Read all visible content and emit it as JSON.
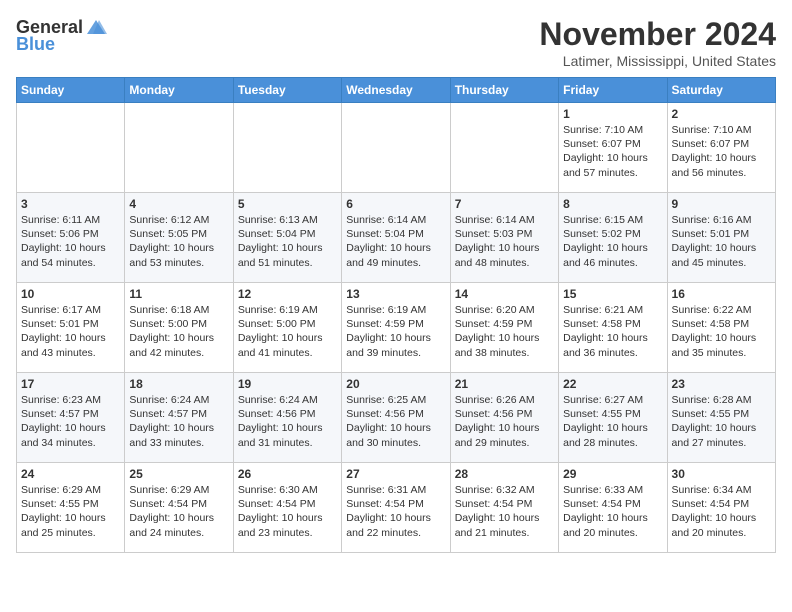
{
  "header": {
    "logo_general": "General",
    "logo_blue": "Blue",
    "month_title": "November 2024",
    "location": "Latimer, Mississippi, United States"
  },
  "weekdays": [
    "Sunday",
    "Monday",
    "Tuesday",
    "Wednesday",
    "Thursday",
    "Friday",
    "Saturday"
  ],
  "weeks": [
    [
      {
        "day": "",
        "info": ""
      },
      {
        "day": "",
        "info": ""
      },
      {
        "day": "",
        "info": ""
      },
      {
        "day": "",
        "info": ""
      },
      {
        "day": "",
        "info": ""
      },
      {
        "day": "1",
        "info": "Sunrise: 7:10 AM\nSunset: 6:07 PM\nDaylight: 10 hours\nand 57 minutes."
      },
      {
        "day": "2",
        "info": "Sunrise: 7:10 AM\nSunset: 6:07 PM\nDaylight: 10 hours\nand 56 minutes."
      }
    ],
    [
      {
        "day": "3",
        "info": "Sunrise: 6:11 AM\nSunset: 5:06 PM\nDaylight: 10 hours\nand 54 minutes."
      },
      {
        "day": "4",
        "info": "Sunrise: 6:12 AM\nSunset: 5:05 PM\nDaylight: 10 hours\nand 53 minutes."
      },
      {
        "day": "5",
        "info": "Sunrise: 6:13 AM\nSunset: 5:04 PM\nDaylight: 10 hours\nand 51 minutes."
      },
      {
        "day": "6",
        "info": "Sunrise: 6:14 AM\nSunset: 5:04 PM\nDaylight: 10 hours\nand 49 minutes."
      },
      {
        "day": "7",
        "info": "Sunrise: 6:14 AM\nSunset: 5:03 PM\nDaylight: 10 hours\nand 48 minutes."
      },
      {
        "day": "8",
        "info": "Sunrise: 6:15 AM\nSunset: 5:02 PM\nDaylight: 10 hours\nand 46 minutes."
      },
      {
        "day": "9",
        "info": "Sunrise: 6:16 AM\nSunset: 5:01 PM\nDaylight: 10 hours\nand 45 minutes."
      }
    ],
    [
      {
        "day": "10",
        "info": "Sunrise: 6:17 AM\nSunset: 5:01 PM\nDaylight: 10 hours\nand 43 minutes."
      },
      {
        "day": "11",
        "info": "Sunrise: 6:18 AM\nSunset: 5:00 PM\nDaylight: 10 hours\nand 42 minutes."
      },
      {
        "day": "12",
        "info": "Sunrise: 6:19 AM\nSunset: 5:00 PM\nDaylight: 10 hours\nand 41 minutes."
      },
      {
        "day": "13",
        "info": "Sunrise: 6:19 AM\nSunset: 4:59 PM\nDaylight: 10 hours\nand 39 minutes."
      },
      {
        "day": "14",
        "info": "Sunrise: 6:20 AM\nSunset: 4:59 PM\nDaylight: 10 hours\nand 38 minutes."
      },
      {
        "day": "15",
        "info": "Sunrise: 6:21 AM\nSunset: 4:58 PM\nDaylight: 10 hours\nand 36 minutes."
      },
      {
        "day": "16",
        "info": "Sunrise: 6:22 AM\nSunset: 4:58 PM\nDaylight: 10 hours\nand 35 minutes."
      }
    ],
    [
      {
        "day": "17",
        "info": "Sunrise: 6:23 AM\nSunset: 4:57 PM\nDaylight: 10 hours\nand 34 minutes."
      },
      {
        "day": "18",
        "info": "Sunrise: 6:24 AM\nSunset: 4:57 PM\nDaylight: 10 hours\nand 33 minutes."
      },
      {
        "day": "19",
        "info": "Sunrise: 6:24 AM\nSunset: 4:56 PM\nDaylight: 10 hours\nand 31 minutes."
      },
      {
        "day": "20",
        "info": "Sunrise: 6:25 AM\nSunset: 4:56 PM\nDaylight: 10 hours\nand 30 minutes."
      },
      {
        "day": "21",
        "info": "Sunrise: 6:26 AM\nSunset: 4:56 PM\nDaylight: 10 hours\nand 29 minutes."
      },
      {
        "day": "22",
        "info": "Sunrise: 6:27 AM\nSunset: 4:55 PM\nDaylight: 10 hours\nand 28 minutes."
      },
      {
        "day": "23",
        "info": "Sunrise: 6:28 AM\nSunset: 4:55 PM\nDaylight: 10 hours\nand 27 minutes."
      }
    ],
    [
      {
        "day": "24",
        "info": "Sunrise: 6:29 AM\nSunset: 4:55 PM\nDaylight: 10 hours\nand 25 minutes."
      },
      {
        "day": "25",
        "info": "Sunrise: 6:29 AM\nSunset: 4:54 PM\nDaylight: 10 hours\nand 24 minutes."
      },
      {
        "day": "26",
        "info": "Sunrise: 6:30 AM\nSunset: 4:54 PM\nDaylight: 10 hours\nand 23 minutes."
      },
      {
        "day": "27",
        "info": "Sunrise: 6:31 AM\nSunset: 4:54 PM\nDaylight: 10 hours\nand 22 minutes."
      },
      {
        "day": "28",
        "info": "Sunrise: 6:32 AM\nSunset: 4:54 PM\nDaylight: 10 hours\nand 21 minutes."
      },
      {
        "day": "29",
        "info": "Sunrise: 6:33 AM\nSunset: 4:54 PM\nDaylight: 10 hours\nand 20 minutes."
      },
      {
        "day": "30",
        "info": "Sunrise: 6:34 AM\nSunset: 4:54 PM\nDaylight: 10 hours\nand 20 minutes."
      }
    ]
  ]
}
